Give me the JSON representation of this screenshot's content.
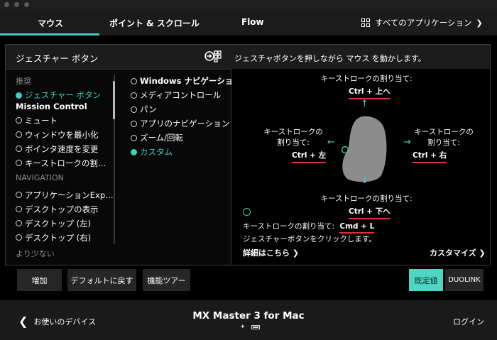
{
  "tabs": {
    "items": [
      {
        "label": "マウス",
        "active": true
      },
      {
        "label": "ポイント & スクロール",
        "active": false
      },
      {
        "label": "Flow",
        "active": false
      }
    ],
    "apps_label": "すべてのアプリケーション"
  },
  "header": {
    "title": "ジェスチャー ボタン",
    "description": "ジェスチャボタンを押しながら マウス を動かします。"
  },
  "list_a": {
    "section_recommended": "推奨",
    "items": [
      {
        "label": "ジェスチャー ボタン",
        "selected": true
      },
      {
        "label": "Mission Control",
        "selected": false
      },
      {
        "label": "ミュート",
        "selected": false
      },
      {
        "label": "ウィンドウを最小化",
        "selected": false
      },
      {
        "label": "ポインタ速度を変更",
        "selected": false
      },
      {
        "label": "キーストロークの割…",
        "selected": false
      }
    ],
    "section_navigation": "NAVIGATION",
    "nav_items": [
      {
        "label": "アプリケーションExp…"
      },
      {
        "label": "デスクトップの表示"
      },
      {
        "label": "デスクトップ (左)"
      },
      {
        "label": "デスクトップ (右)"
      }
    ],
    "less_label": "より少ない"
  },
  "list_b": {
    "items": [
      {
        "label": "Windows ナビゲーション",
        "selected": false
      },
      {
        "label": "メディアコントロール",
        "selected": false
      },
      {
        "label": "パン",
        "selected": false
      },
      {
        "label": "アプリのナビゲーション",
        "selected": false
      },
      {
        "label": "ズーム/回転",
        "selected": false
      },
      {
        "label": "カスタム",
        "selected": true
      }
    ]
  },
  "gesture": {
    "up_caption": "キーストロークの割り当て:",
    "up_key": "Ctrl + 上へ",
    "left_caption_1": "キーストロークの",
    "left_caption_2": "割り当て:",
    "left_key": "Ctrl + 左",
    "right_caption_1": "キーストロークの",
    "right_caption_2": "割り当て:",
    "right_key": "Ctrl + 右",
    "down_caption": "キーストロークの割り当て:",
    "down_key": "Ctrl + 下へ",
    "click_caption": "キーストロークの割り当て:",
    "click_key": "Cmd + L",
    "click_desc": "ジェスチャーボタンをクリックします。",
    "details_link": "詳細はこちら",
    "customize_link": "カスタマイズ"
  },
  "buttons": {
    "add": "増加",
    "reset": "デフォルトに戻す",
    "tour": "機能ツアー",
    "default": "既定値",
    "duolink": "DUOLINK"
  },
  "status": {
    "back_label": "お使いのデバイス",
    "device_name": "MX Master 3 for Mac",
    "login": "ログイン"
  },
  "colors": {
    "accent": "#3fcfbf",
    "key_underline": "#e0303a",
    "default_button": "#4dd6c4"
  }
}
